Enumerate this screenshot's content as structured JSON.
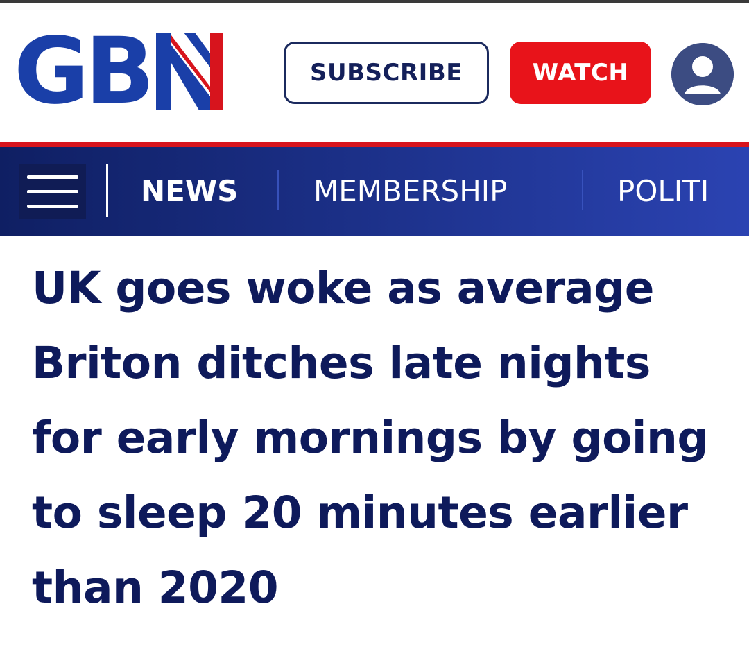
{
  "header": {
    "logo_text": "GB",
    "logo_letter": "N",
    "subscribe_label": "SUBSCRIBE",
    "watch_label": "WATCH"
  },
  "nav": {
    "items": [
      {
        "label": "NEWS"
      },
      {
        "label": "MEMBERSHIP"
      },
      {
        "label": "POLITI"
      }
    ]
  },
  "article": {
    "headline": "UK goes woke as average Briton ditches late nights for early mornings by going to sleep 20 minutes earlier than 2020"
  },
  "colors": {
    "brand_blue": "#1a3fa8",
    "brand_red": "#e8131a",
    "nav_blue": "#1b2f86",
    "headline_navy": "#0e1a5b"
  },
  "icons": {
    "menu": "hamburger-menu-icon",
    "account": "user-avatar-icon"
  }
}
